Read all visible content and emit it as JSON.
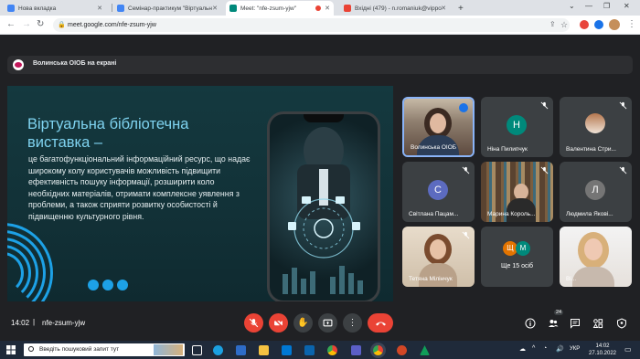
{
  "browser": {
    "tabs": [
      {
        "label": "Нова вкладка",
        "color": "#4285f4"
      },
      {
        "label": "Семінар-практикум \"Віртуальн",
        "color": "#4285f4"
      },
      {
        "label": "Meet: \"nfe-zsum-yjw\"",
        "color": "#00897b"
      },
      {
        "label": "Вхідні (479) - n.romaniuk@vippo",
        "color": "#ea4335"
      }
    ],
    "new_tab": "+",
    "url": "meet.google.com/nfe-zsum-yjw"
  },
  "meet": {
    "presenter_label": "Волинська ОІОБ на екрані",
    "slide": {
      "title": "Віртуальна бібліотечна виставка –",
      "body": "це багатофункціональний інформаційний ресурс, що надає широкому колу користувачів можливість підвищити ефективність пошуку інформації, розширити коло необхідних матеріалів, отримати комплексне уявлення з проблеми, а також сприяти розвитку особистості й підвищенню культурного рівня."
    },
    "participants": [
      {
        "name": "Волинська ОІОБ",
        "type": "photo"
      },
      {
        "name": "Ніна Пилипчук",
        "initial": "Н",
        "color": "#00897b"
      },
      {
        "name": "Валентина Стри...",
        "type": "photo"
      },
      {
        "name": "Світлана Пацам...",
        "initial": "С",
        "color": "#5c6bc0"
      },
      {
        "name": "Марина Король...",
        "type": "photo"
      },
      {
        "name": "Людмила Якові...",
        "initial": "Л",
        "color": "#757575"
      },
      {
        "name": "Тетяна Мілінчук",
        "type": "photo"
      },
      {
        "name": "Ще 15 осіб",
        "initials": [
          "Щ",
          "М"
        ]
      },
      {
        "name": "Ві...",
        "type": "photo"
      }
    ],
    "time": "14:02",
    "separator": "|",
    "meeting_code": "nfe-zsum-yjw",
    "participant_count": "24"
  },
  "taskbar": {
    "search_placeholder": "Введіть пошуковий запит тут",
    "language": "УКР",
    "time": "14:02",
    "date": "27.10.2022"
  }
}
